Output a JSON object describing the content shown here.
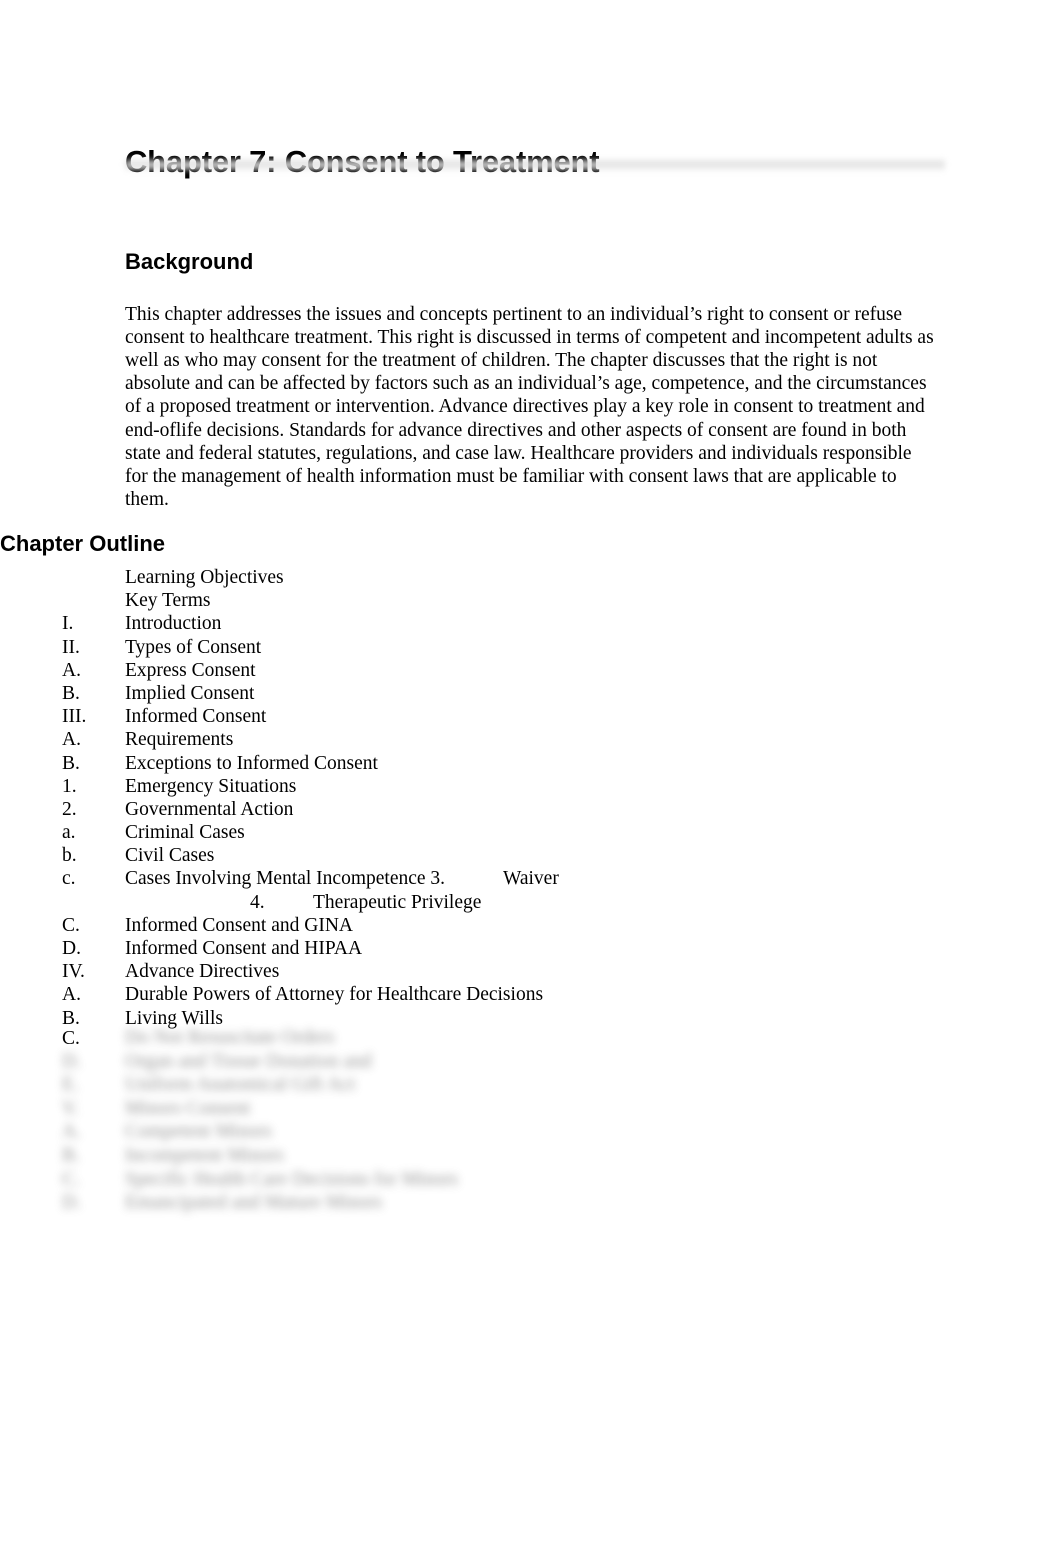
{
  "document": {
    "title": "Chapter 7: Consent to Treatment"
  },
  "background_section": {
    "heading": "Background",
    "paragraph": "This chapter addresses the issues and concepts pertinent to an individual’s right to consent or refuse consent to healthcare treatment. This right is discussed in terms of competent and incompetent adults as well as who may consent for the treatment of children. The chapter discusses that the right is not absolute and can be affected by factors such as an individual’s age, competence, and the circumstances of a proposed treatment or intervention. Advance directives play a key role in consent to treatment and end-oflife decisions. Standards for advance directives and other aspects of consent are found in both state and federal statutes, regulations, and case law. Healthcare providers and individuals responsible for the management of health information must be familiar with consent laws that are applicable to them."
  },
  "outline_section": {
    "heading": "Chapter Outline",
    "items": [
      {
        "marker": "",
        "label": "Learning Objectives"
      },
      {
        "marker": "",
        "label": "Key Terms"
      },
      {
        "marker": "I.",
        "label": "Introduction"
      },
      {
        "marker": "II.",
        "label": "Types of Consent"
      },
      {
        "marker": "A.",
        "label": "Express Consent"
      },
      {
        "marker": "B.",
        "label": "Implied Consent"
      },
      {
        "marker": "III.",
        "label": "Informed Consent"
      },
      {
        "marker": "A.",
        "label": "Requirements"
      },
      {
        "marker": "B.",
        "label": "Exceptions to Informed Consent"
      },
      {
        "marker": "1.",
        "label": "Emergency Situations"
      },
      {
        "marker": "2.",
        "label": "Governmental Action"
      },
      {
        "marker": "a.",
        "label": "Criminal Cases"
      },
      {
        "marker": "b.",
        "label": "Civil Cases"
      },
      {
        "marker": "c.",
        "label": "Cases Involving Mental Incompetence 3.",
        "extra": "Waiver"
      },
      {
        "marker": "4.",
        "label": "Therapeutic Privilege",
        "deep": true
      },
      {
        "marker": "C.",
        "label": "Informed Consent and GINA"
      },
      {
        "marker": "D.",
        "label": "Informed Consent and HIPAA"
      },
      {
        "marker": "IV.",
        "label": "Advance Directives"
      },
      {
        "marker": "A.",
        "label": "Durable Powers of Attorney for Healthcare Decisions"
      },
      {
        "marker": "B.",
        "label": "Living Wills"
      }
    ],
    "redacted_marker": "C.",
    "redacted_note": "illegible blurred text",
    "redacted_items": [
      {
        "marker": "",
        "label": "Do Not Resuscitate Orders"
      },
      {
        "marker": "D.",
        "label": "Organ and Tissue Donation and"
      },
      {
        "marker": "E.",
        "label": "Uniform Anatomical Gift Act"
      },
      {
        "marker": "V.",
        "label": "Minors Consent"
      },
      {
        "marker": "A.",
        "label": "Competent Minors"
      },
      {
        "marker": "B.",
        "label": "Incompetent Minors"
      },
      {
        "marker": "C.",
        "label": "Specific Health Care Decisions for Minors"
      },
      {
        "marker": "D.",
        "label": "Emancipated and Mature Minors"
      }
    ]
  },
  "colors": {
    "text": "#000000",
    "page_background": "#ffffff",
    "rule": "#e2e2e2"
  }
}
